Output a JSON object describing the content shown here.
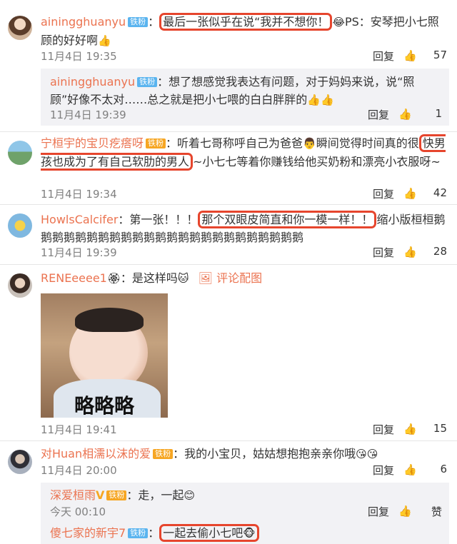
{
  "comments": [
    {
      "user": "ainingghuanyu",
      "badge": "铁粉",
      "sep": "：",
      "highlight": "最后一张似乎在说“我并不想你！",
      "rest": "PS：安琴把小七照顾的好好啊",
      "time": "11月4日 19:35",
      "reply": "回复",
      "likes": "57",
      "replies": [
        {
          "user": "ainingghuanyu",
          "badge": "铁粉",
          "text": "：想了想感觉我表达有问题，对于妈妈来说，说“照顾”好像不太对……总之就是把小七喂的白白胖胖的",
          "time": "11月4日 19:39",
          "reply": "回复",
          "likes": "1"
        }
      ]
    },
    {
      "user": "宁桓宇的宝贝疙瘩呀",
      "badge": "铁粉",
      "pre": "：听着七哥称呼自己为爸爸",
      "mid": "瞬间觉得时间真的很",
      "highlight": "快男孩也成为了有自己软肋的男人",
      "rest": "~小七七等着你赚钱给他买奶粉和漂亮小衣服呀~",
      "time": "11月4日 19:34",
      "reply": "回复",
      "likes": "42"
    },
    {
      "user": "HowlsCalcifer",
      "pre": "：第一张！！！",
      "highlight": "那个双眼皮简直和你一模一样！！",
      "rest": "缩小版桓桓鹅鹅鹅鹅鹅鹅鹅鹅鹅鹅鹅鹅鹅鹅鹅鹅鹅鹅鹅鹅鹅鹅鹅鹅",
      "time": "11月4日 19:39",
      "reply": "回复",
      "likes": "28"
    },
    {
      "user": "RENEeeee1",
      "pre": "：是这样吗",
      "link": "评论配图",
      "image_caption": "略略略",
      "time": "11月4日 19:41",
      "reply": "回复",
      "likes": "15"
    },
    {
      "user": "对Huan相濡以沫的爱",
      "badge": "铁粉",
      "pre": "：我的小宝贝，姑姑想抱抱亲亲你哦",
      "time": "11月4日 20:00",
      "reply": "回复",
      "likes": "6",
      "replies": [
        {
          "user": "深爱桓雨",
          "badge": "铁粉",
          "text": "：走，一起",
          "time": "今天 00:10",
          "reply": "回复",
          "likes": "赞"
        },
        {
          "user": "傻七家的新宇7",
          "badge": "铁粉",
          "highlight": "一起去偷小七吧",
          "sep": "："
        }
      ]
    }
  ]
}
